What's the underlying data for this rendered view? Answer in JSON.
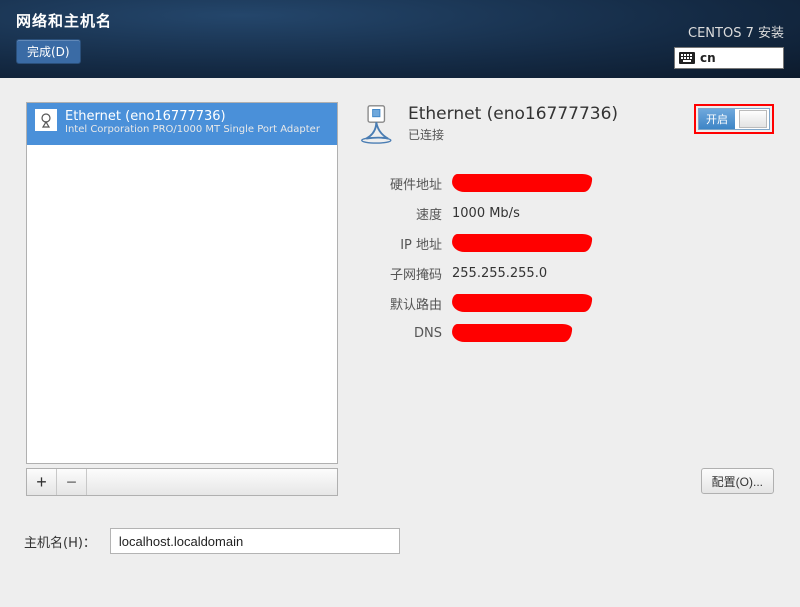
{
  "header": {
    "title": "网络和主机名",
    "done_label": "完成(D)",
    "installer_label": "CENTOS 7 安装",
    "lang_code": "cn"
  },
  "device_list": {
    "items": [
      {
        "title": "Ethernet (eno16777736)",
        "subtitle": "Intel Corporation PRO/1000 MT Single Port Adapter"
      }
    ]
  },
  "buttons": {
    "add": "+",
    "remove": "−",
    "configure": "配置(O)..."
  },
  "details": {
    "title": "Ethernet (eno16777736)",
    "status": "已连接",
    "toggle_on_label": "开启",
    "rows": {
      "hw_label": "硬件地址",
      "hw_value": "[redacted]",
      "speed_label": "速度",
      "speed_value": "1000 Mb/s",
      "ip_label": "IP 地址",
      "ip_value": "[redacted]",
      "mask_label": "子网掩码",
      "mask_value": "255.255.255.0",
      "route_label": "默认路由",
      "route_value": "[redacted]",
      "dns_label": "DNS",
      "dns_value": "[redacted]"
    }
  },
  "hostname": {
    "label": "主机名(H)：",
    "value": "localhost.localdomain"
  }
}
